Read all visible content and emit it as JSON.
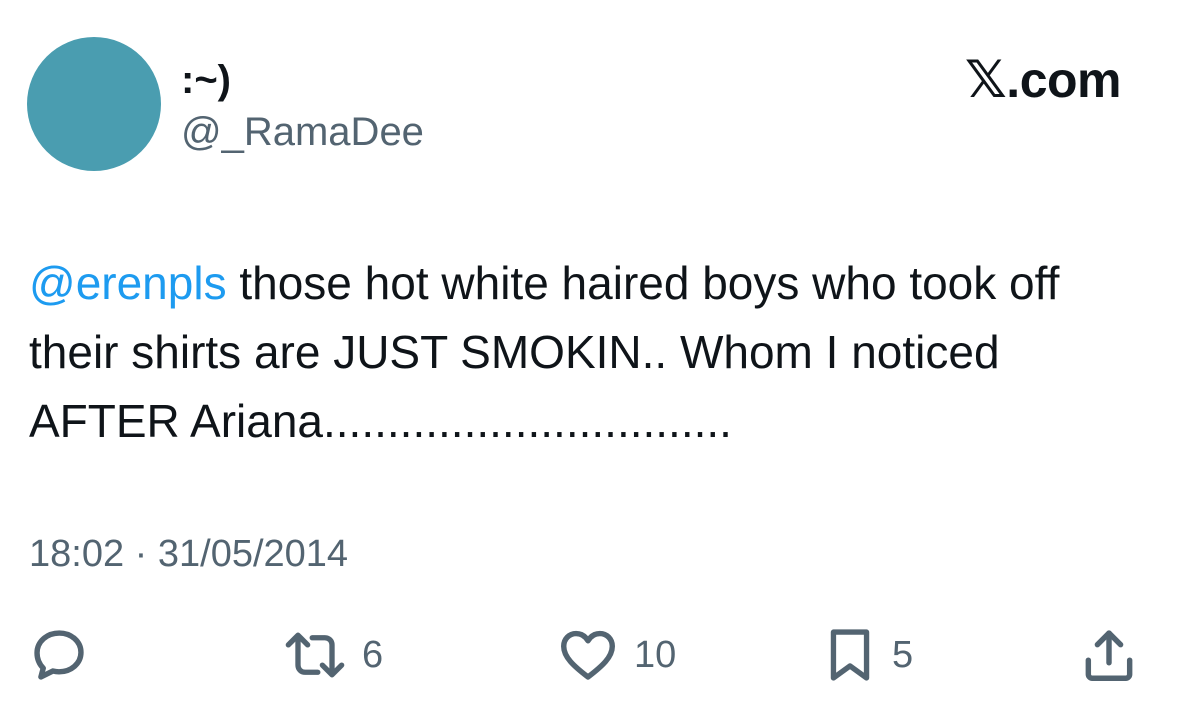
{
  "author": {
    "display_name": ":~)",
    "handle": "@_RamaDee",
    "avatar_color": "#4a9db0"
  },
  "brand": {
    "glyph": "𝕏",
    "suffix": ".com"
  },
  "tweet": {
    "mention": "@erenpls",
    "text": " those hot white haired boys who took off their shirts are JUST SMOKIN.. Whom I noticed AFTER Ariana................................",
    "timestamp": "18:02 · 31/05/2014"
  },
  "actions": {
    "reply_icon": "reply-icon",
    "retweet_icon": "retweet-icon",
    "retweet_count": "6",
    "like_icon": "heart-icon",
    "like_count": "10",
    "bookmark_icon": "bookmark-icon",
    "bookmark_count": "5",
    "share_icon": "share-icon"
  },
  "colors": {
    "text": "#0f1419",
    "secondary": "#536471",
    "link": "#1d9bf0"
  }
}
